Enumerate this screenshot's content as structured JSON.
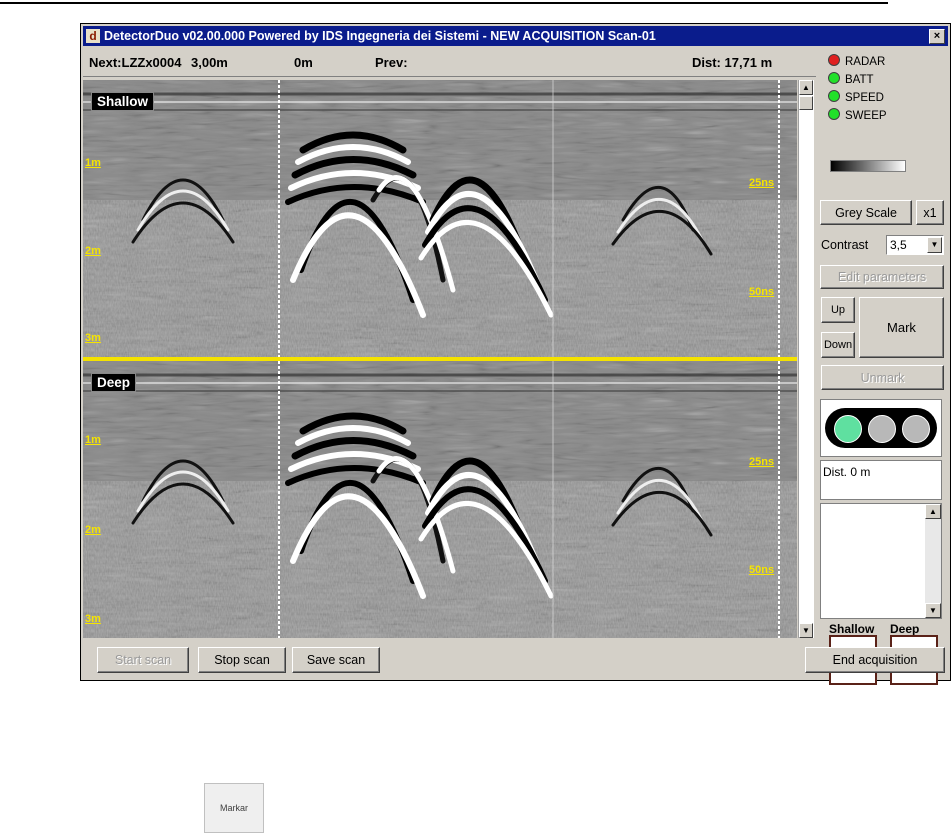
{
  "window": {
    "title": "DetectorDuo v02.00.000 Powered by IDS Ingegneria dei Sistemi - NEW ACQUISITION  Scan-01",
    "close_glyph": "×",
    "app_icon_glyph": "d"
  },
  "infobar": {
    "next": "Next:LZZx0004",
    "next_pos": "3,00m",
    "offset": "0m",
    "prev": "Prev:",
    "dist": "Dist: 17,71 m"
  },
  "panels": {
    "shallow": {
      "label": "Shallow",
      "depth_labels": [
        "1m",
        "2m",
        "3m"
      ],
      "time_labels": [
        "25ns",
        "50ns"
      ]
    },
    "deep": {
      "label": "Deep",
      "depth_labels": [
        "1m",
        "2m",
        "3m"
      ],
      "time_labels": [
        "25ns",
        "50ns"
      ]
    }
  },
  "scrollbar": {
    "up_glyph": "▲",
    "down_glyph": "▼"
  },
  "status_indicators": [
    {
      "label": "RADAR",
      "color": "#e02020"
    },
    {
      "label": "BATT",
      "color": "#22e02a"
    },
    {
      "label": "SPEED",
      "color": "#22e02a"
    },
    {
      "label": "SWEEP",
      "color": "#22e02a"
    }
  ],
  "controls": {
    "grey_scale": "Grey Scale",
    "zoom": "x1",
    "contrast_label": "Contrast",
    "contrast_value": "3,5",
    "dropdown_glyph": "▼",
    "edit_parameters": "Edit parameters",
    "up": "Up",
    "down": "Down",
    "mark": "Mark",
    "unmark": "Unmark"
  },
  "traffic_light": {
    "active_color": "#5fe0a0",
    "inactive_color": "#b8b8b8"
  },
  "dist_box": {
    "text": "Dist. 0 m"
  },
  "notes": {
    "up_glyph": "▲",
    "down_glyph": "▼"
  },
  "thumbnails": {
    "shallow": "Shallow",
    "deep": "Deep"
  },
  "bottom_buttons": {
    "start": "Start scan",
    "stop": "Stop scan",
    "save": "Save scan",
    "end": "End acquisition"
  },
  "caption_button": {
    "label": "Markar"
  }
}
